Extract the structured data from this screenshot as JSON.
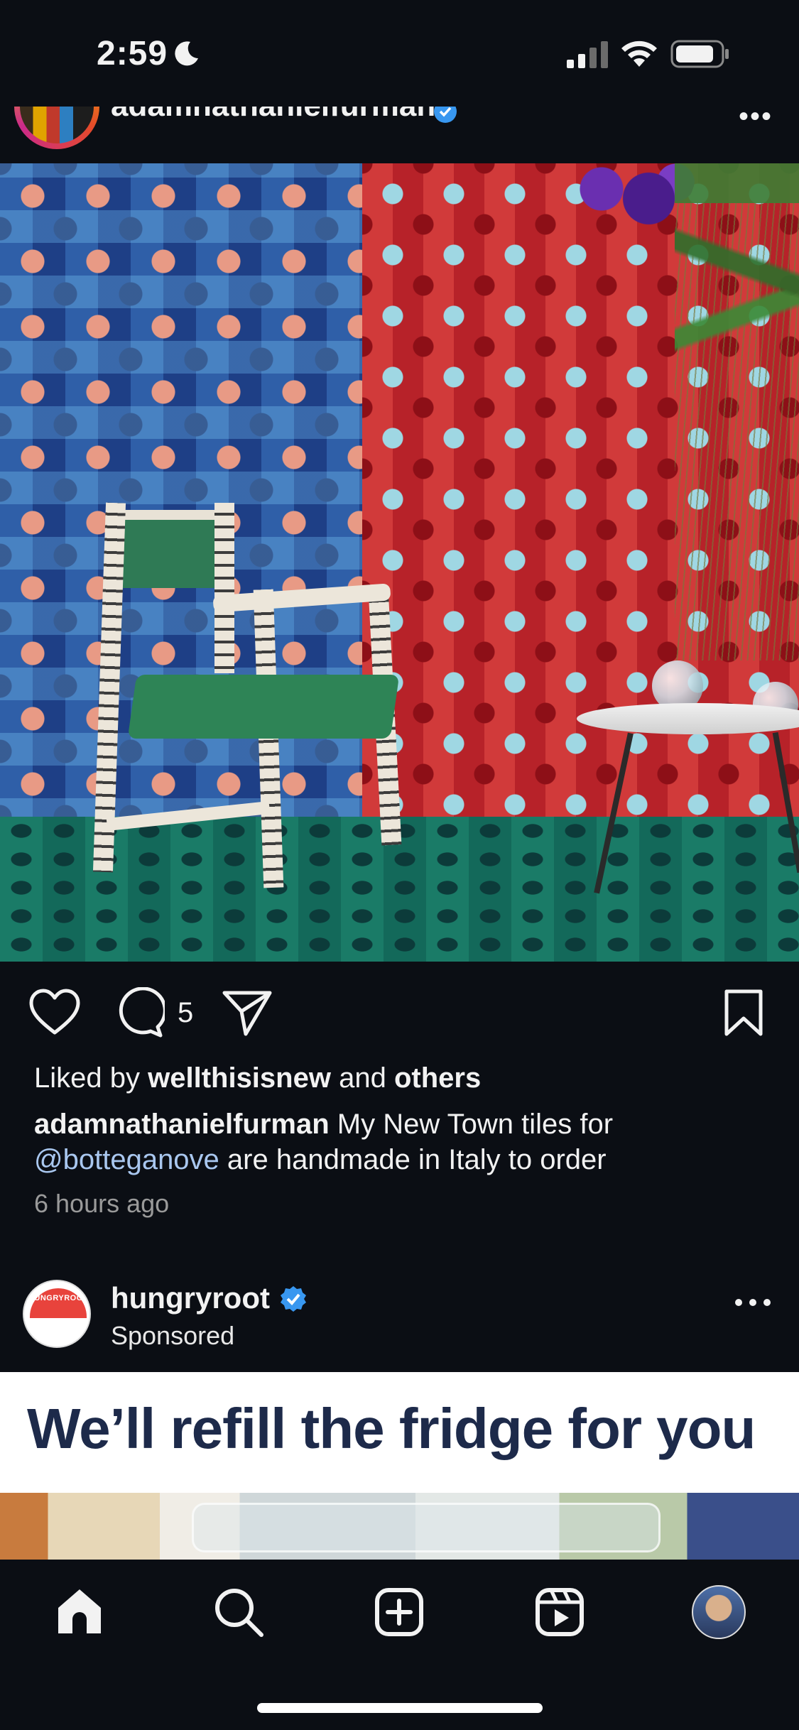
{
  "status_bar": {
    "time": "2:59",
    "icons": [
      "moon-icon",
      "cellular-signal-icon",
      "wifi-icon",
      "battery-icon"
    ]
  },
  "previous_post": {
    "username": "adamnathanielfurman",
    "verified": true,
    "image_description_icons": [
      "photo"
    ],
    "actions": {
      "comment_count": "5"
    },
    "liked_by_prefix": "Liked by ",
    "liked_by_user": "wellthisisnew",
    "liked_by_joiner": " and ",
    "liked_by_others": "others",
    "caption_username": "adamnathanielfurman",
    "caption_text_1": " My New Town tiles for ",
    "caption_mention": "@botteganove",
    "caption_text_2": " are handmade in Italy to order",
    "timestamp": "6 hours ago"
  },
  "sponsored_post": {
    "avatar_text": "HUNGRYROOT",
    "username": "hungryroot",
    "verified": true,
    "label": "Sponsored",
    "headline": "We’ll refill the fridge for you"
  },
  "bottom_nav": {
    "items": [
      "home-icon",
      "search-icon",
      "create-icon",
      "reels-icon",
      "profile-avatar"
    ]
  },
  "colors": {
    "background": "#0b0e14",
    "text": "#f2f2f2",
    "mention": "#a9c7ef",
    "verified": "#3897f0",
    "ad_headline": "#1d2a4a"
  }
}
